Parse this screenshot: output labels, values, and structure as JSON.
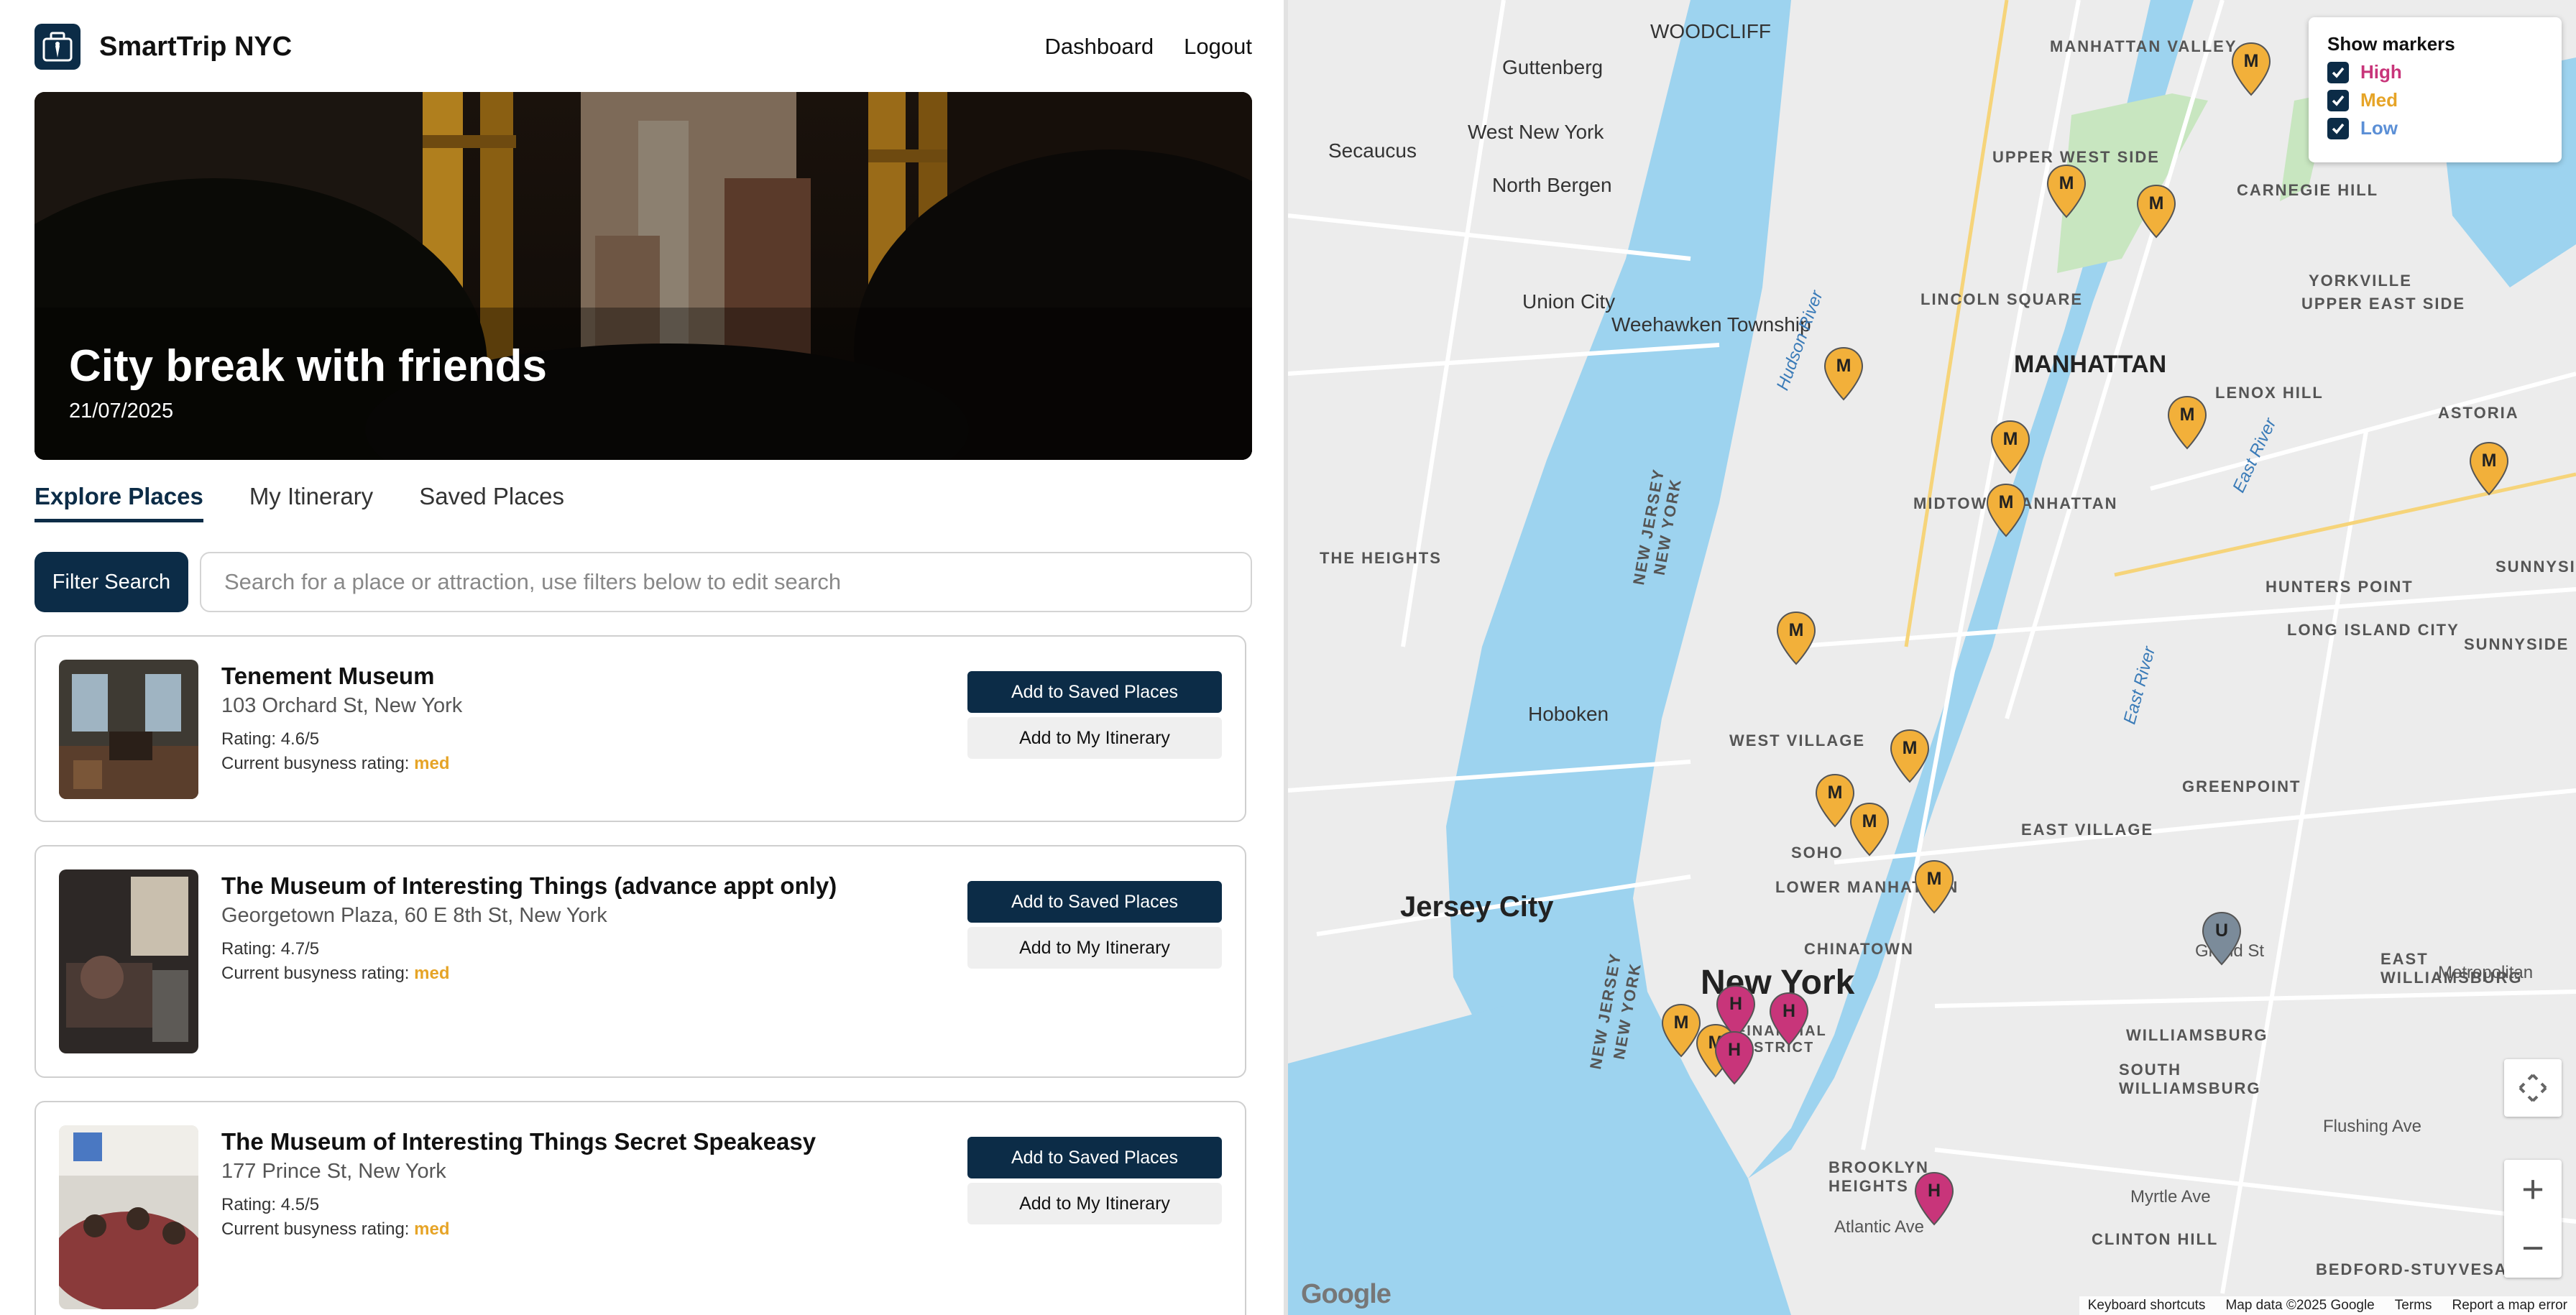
{
  "app": {
    "brand": "SmartTrip NYC"
  },
  "nav": {
    "dashboard": "Dashboard",
    "logout": "Logout"
  },
  "hero": {
    "title": "City break with friends",
    "date": "21/07/2025"
  },
  "tabs": [
    {
      "label": "Explore Places"
    },
    {
      "label": "My Itinerary"
    },
    {
      "label": "Saved Places"
    }
  ],
  "search": {
    "filter_label": "Filter Search",
    "placeholder": "Search for a place or attraction, use filters below to edit search"
  },
  "card_common": {
    "save_label": "Add to Saved Places",
    "itinerary_label": "Add to My Itinerary",
    "busy_prefix": "Current busyness rating:"
  },
  "places": [
    {
      "name": "Tenement Museum",
      "address": "103 Orchard St, New York",
      "rating": "Rating: 4.6/5",
      "busyness": "med"
    },
    {
      "name": "The Museum of Interesting Things (advance appt only)",
      "address": "Georgetown Plaza, 60 E 8th St, New York",
      "rating": "Rating: 4.7/5",
      "busyness": "med"
    },
    {
      "name": "The Museum of Interesting Things Secret Speakeasy",
      "address": "177 Prince St, New York",
      "rating": "Rating: 4.5/5",
      "busyness": "med"
    }
  ],
  "legend": {
    "title": "Show markers",
    "items": [
      {
        "label": "High",
        "color": "#c8357a"
      },
      {
        "label": "Med",
        "color": "#e6a427"
      },
      {
        "label": "Low",
        "color": "#5b8fd6"
      }
    ]
  },
  "markers": {
    "high": "H",
    "med": "M",
    "low": "U"
  },
  "map_labels": {
    "woodcliff": "WOODCLIFF",
    "guttenberg": "Guttenberg",
    "west_ny": "West New York",
    "secaucus": "Secaucus",
    "north_bergen": "North Bergen",
    "union_city": "Union City",
    "weehawken": "Weehawken Township",
    "manhattan_valley": "MANHATTAN VALLEY",
    "upper_west": "UPPER WEST SIDE",
    "carnegie": "CARNEGIE HILL",
    "yorkville": "YORKVILLE",
    "upper_east": "UPPER EAST SIDE",
    "lincoln_sq": "LINCOLN SQUARE",
    "manhattan": "MANHATTAN",
    "lenox_hill": "LENOX HILL",
    "astoria": "ASTORIA",
    "midtown": "MIDTOWN MANHATTAN",
    "the_heights": "THE HEIGHTS",
    "hunters_point": "HUNTERS POINT",
    "lic": "LONG ISLAND CITY",
    "sunnyside": "SUNNYSIDE",
    "sunnyside_gardens": "SUNNYSIDE GARDENS",
    "hoboken": "Hoboken",
    "west_village": "WEST VILLAGE",
    "greenpoint": "GREENPOINT",
    "east_village": "EAST VILLAGE",
    "soho": "SOHO",
    "lower_manhattan": "LOWER MANHATTAN",
    "jersey_city": "Jersey City",
    "chinatown": "CHINATOWN",
    "new_york": "New York",
    "financial": "FINANCIAL DISTRICT",
    "east_williamsburg": "EAST WILLIAMSBURG",
    "williamsburg": "WILLIAMSBURG",
    "south_williamsburg": "SOUTH WILLIAMSBURG",
    "brooklyn_heights": "BROOKLYN HEIGHTS",
    "clinton_hill": "CLINTON HILL",
    "bed_stuy": "BEDFORD-STUYVESANT",
    "nj": "NEW JERSEY",
    "ny": "NEW YORK",
    "hudson": "Hudson River",
    "east_river": "East River",
    "grand_st": "Grand St",
    "metropolitan": "Metropolitan",
    "flushing": "Flushing Ave",
    "myrtle": "Myrtle Ave",
    "atlantic": "Atlantic Ave"
  },
  "map_footer": {
    "google": "Google",
    "shortcuts": "Keyboard shortcuts",
    "mapdata": "Map data ©2025 Google",
    "terms": "Terms",
    "report": "Report a map error"
  }
}
